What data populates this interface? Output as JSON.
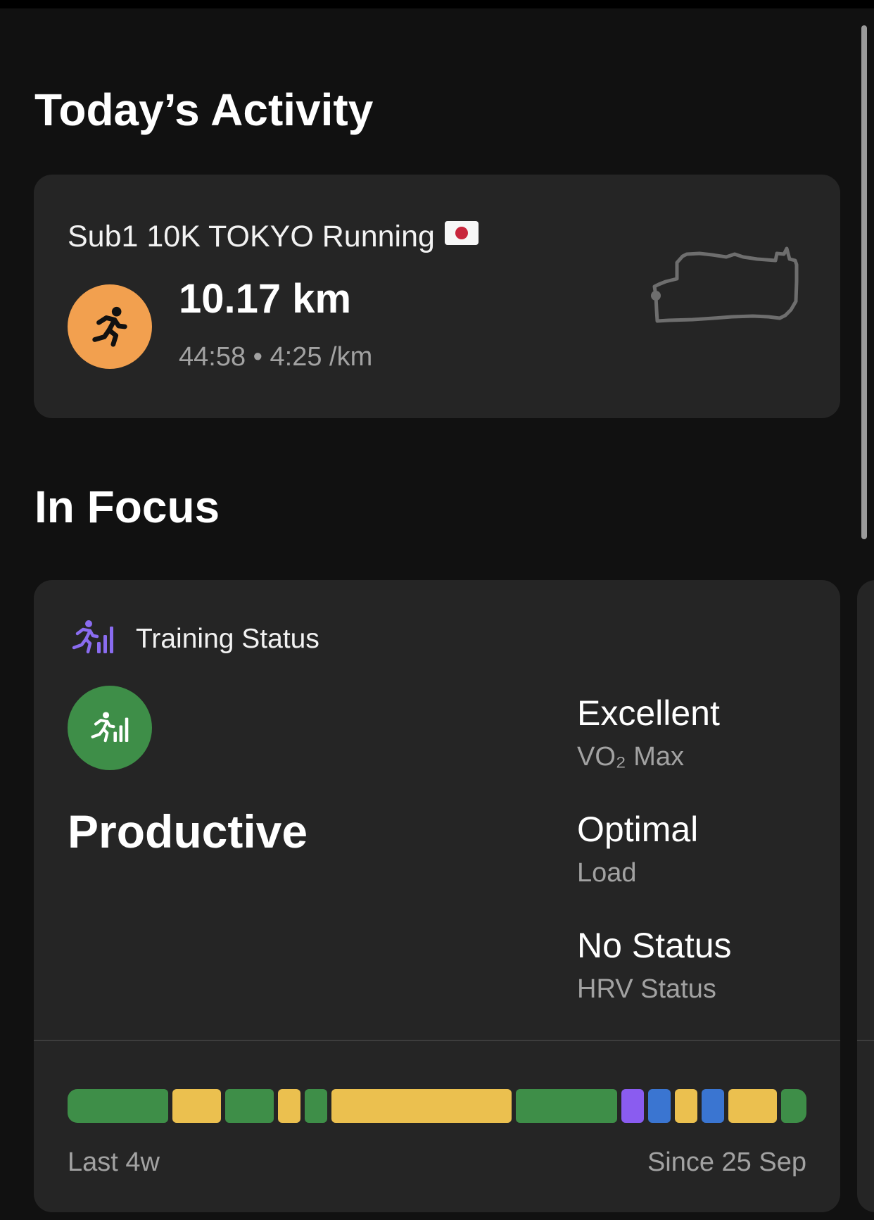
{
  "todays_activity": {
    "section_title": "Today’s Activity",
    "activity": {
      "title": "Sub1 10K TOKYO Running",
      "flag_icon": "japan-flag-icon",
      "type_icon": "running-person-icon",
      "distance": "10.17 km",
      "duration_pace": "44:58 • 4:25 /km",
      "route_icon": "route-map-icon"
    }
  },
  "in_focus": {
    "section_title": "In Focus",
    "training_status": {
      "header_label": "Training Status",
      "header_icon": "training-status-icon",
      "status": "Productive",
      "metrics": [
        {
          "value": "Excellent",
          "label": "VO₂ Max"
        },
        {
          "value": "Optimal",
          "label": "Load"
        },
        {
          "value": "No Status",
          "label": "HRV Status"
        }
      ],
      "history": {
        "range_start_label": "Last 4w",
        "range_end_label": "Since 25 Sep",
        "segments": [
          {
            "status": "productive",
            "color": "#3e8e48",
            "weight": 130
          },
          {
            "status": "maintaining",
            "color": "#ebc04f",
            "weight": 63
          },
          {
            "status": "productive",
            "color": "#3e8e48",
            "weight": 63
          },
          {
            "status": "maintaining",
            "color": "#ebc04f",
            "weight": 29
          },
          {
            "status": "productive",
            "color": "#3e8e48",
            "weight": 29
          },
          {
            "status": "maintaining",
            "color": "#ebc04f",
            "weight": 233
          },
          {
            "status": "productive",
            "color": "#3e8e48",
            "weight": 131
          },
          {
            "status": "peaking",
            "color": "#8a5cf0",
            "weight": 29
          },
          {
            "status": "recovery",
            "color": "#3a75d1",
            "weight": 29
          },
          {
            "status": "maintaining",
            "color": "#ebc04f",
            "weight": 29
          },
          {
            "status": "recovery",
            "color": "#3a75d1",
            "weight": 29
          },
          {
            "status": "maintaining",
            "color": "#ebc04f",
            "weight": 63
          },
          {
            "status": "productive",
            "color": "#3e8e48",
            "weight": 33
          }
        ]
      }
    }
  }
}
